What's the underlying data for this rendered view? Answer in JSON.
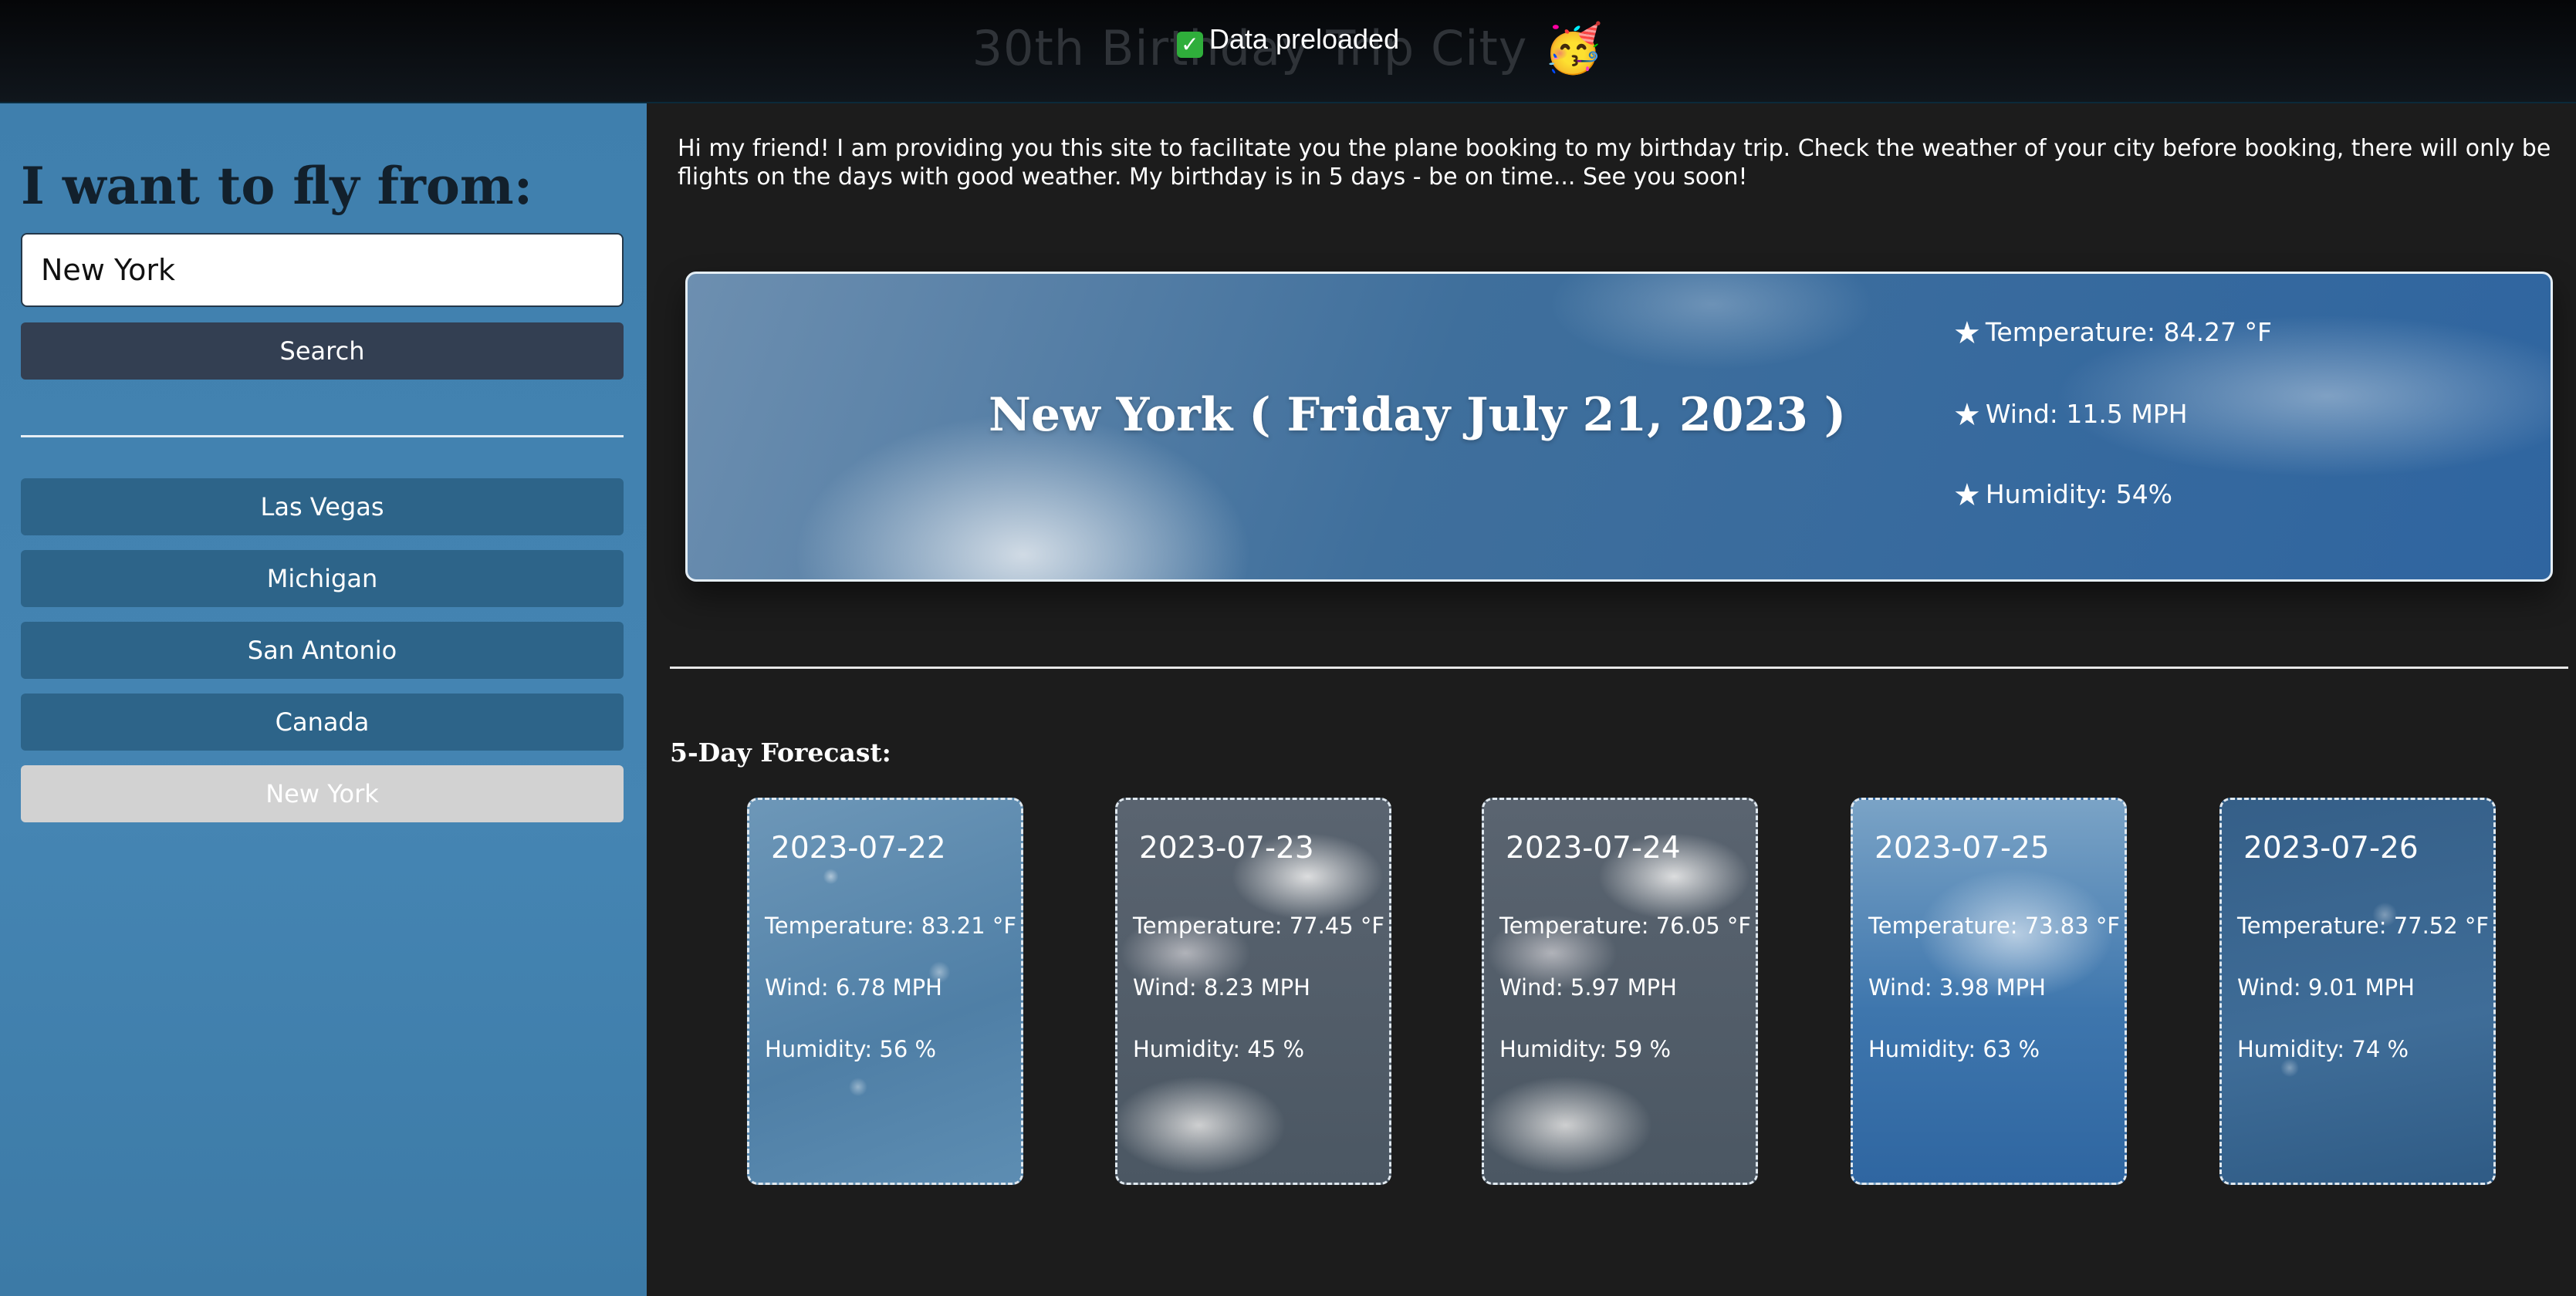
{
  "header": {
    "title": "30th Birthday Trip City 🥳",
    "toast": "Data preloaded",
    "toast_icon": "check-mark-icon"
  },
  "sidebar": {
    "title": "I want to fly from:",
    "search_value": "New York",
    "search_button": "Search",
    "cities": [
      {
        "label": "Las Vegas",
        "active": false
      },
      {
        "label": "Michigan",
        "active": false
      },
      {
        "label": "San Antonio",
        "active": false
      },
      {
        "label": "Canada",
        "active": false
      },
      {
        "label": "New York",
        "active": true
      }
    ]
  },
  "main": {
    "intro": "Hi my friend! I am providing you this site to facilitate you the plane booking to my birthday trip. Check the weather of your city before booking, there will only be flights on the days with good weather. My birthday is in 5 days - be on time... See you soon!",
    "current": {
      "city_date": "New York ( Friday July 21, 2023 )",
      "temperature": "Temperature: 84.27 °F",
      "wind": "Wind: 11.5 MPH",
      "humidity": "Humidity: 54%",
      "star_icon": "★"
    },
    "forecast_title": "5-Day Forecast:",
    "forecast": [
      {
        "date": "2023-07-22",
        "temp": "Temperature: 83.21 °F",
        "wind": "Wind: 6.78 MPH",
        "humidity": "Humidity: 56 %",
        "style": "rain"
      },
      {
        "date": "2023-07-23",
        "temp": "Temperature: 77.45 °F",
        "wind": "Wind: 8.23 MPH",
        "humidity": "Humidity: 45 %",
        "style": "cloudy"
      },
      {
        "date": "2023-07-24",
        "temp": "Temperature: 76.05 °F",
        "wind": "Wind: 5.97 MPH",
        "humidity": "Humidity: 59 %",
        "style": "cloudy"
      },
      {
        "date": "2023-07-25",
        "temp": "Temperature: 73.83 °F",
        "wind": "Wind: 3.98 MPH",
        "humidity": "Humidity: 63 %",
        "style": "clear"
      },
      {
        "date": "2023-07-26",
        "temp": "Temperature: 77.52 °F",
        "wind": "Wind: 9.01 MPH",
        "humidity": "Humidity: 74 %",
        "style": "drops"
      }
    ]
  },
  "colors": {
    "sidebar_bg": "#4585b3",
    "city_button": "#2d6489",
    "active_city_button": "#d2d2d2",
    "search_button": "#333f52",
    "page_bg": "#1c1c1c"
  }
}
